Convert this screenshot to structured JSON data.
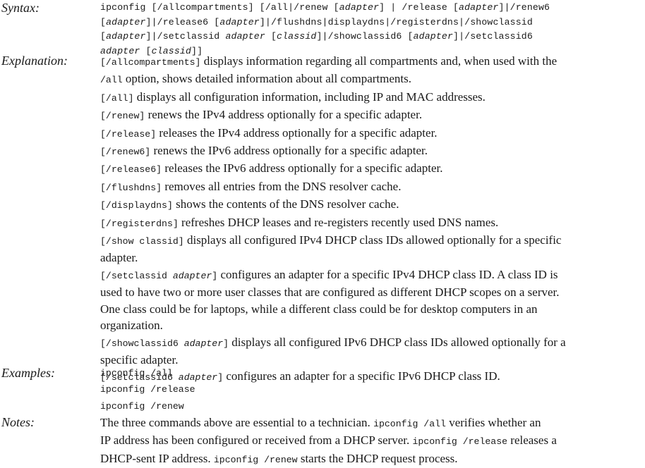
{
  "labels": {
    "syntax": "Syntax",
    "explanation": "Explanation",
    "examples": "Examples",
    "notes": "Notes",
    "colon": ":"
  },
  "syntax": {
    "l1": {
      "p1": "ipconfig [/allcompartments] [/all|/renew [",
      "v1": "adapter",
      "p2": "] | /release [",
      "v2": "adapter",
      "p3": "]|/renew6"
    },
    "l2": {
      "p1": "[",
      "v1": "adapter",
      "p2": "]|/release6 [",
      "v2": "adapter",
      "p3": "]|/flushdns|displaydns|/registerdns|/showclassid"
    },
    "l3": {
      "p1": "[",
      "v1": "adapter",
      "p2": "]|/setclassid ",
      "v2": "adapter",
      "p3": " [",
      "v3": "classid",
      "p4": "]|/showclassid6 [",
      "v4": "adapter",
      "p5": "]|/setclassid6"
    },
    "l4": {
      "v1": "adapter",
      "p1": " [",
      "v2": "classid",
      "p2": "]]"
    }
  },
  "explanation": {
    "e1": {
      "code": "[/allcompartments]",
      "l1": " displays information regarding all compartments and, when used with the",
      "code2": "/all",
      "l2": " option, shows detailed information about all compartments."
    },
    "e2": {
      "code": "[/all]",
      "text": " displays all configuration information, including IP and MAC addresses."
    },
    "e3": {
      "code": "[/renew]",
      "text": " renews the IPv4 address optionally for a specific adapter."
    },
    "e4": {
      "code": "[/release]",
      "text": " releases the IPv4 address optionally for a specific adapter."
    },
    "e5": {
      "code": "[/renew6]",
      "text": " renews the IPv6 address optionally for a specific adapter."
    },
    "e6": {
      "code": "[/release6]",
      "text": " releases the IPv6 address optionally for a specific adapter."
    },
    "e7": {
      "code": "[/flushdns]",
      "text": " removes all entries from the DNS resolver cache."
    },
    "e8": {
      "code": "[/displaydns]",
      "text": " shows the contents of the DNS resolver cache."
    },
    "e9": {
      "code": "[/registerdns]",
      "text": " refreshes DHCP leases and re-registers recently used DNS names."
    },
    "e10": {
      "code": "[/show classid]",
      "l1": " displays all configured IPv4 DHCP class IDs allowed optionally for a specific",
      "l2": "adapter."
    },
    "e11": {
      "code1": "[/setclassid ",
      "var": "adapter",
      "code2": "]",
      "l1": " configures an adapter for a specific IPv4 DHCP class ID. A class ID is",
      "l2": "used to have two or more user classes that are configured as different DHCP scopes on a server.",
      "l3": "One class could be for laptops, while a different class could be for desktop computers in an",
      "l4": "organization."
    },
    "e12": {
      "code1": "[/showclassid6 ",
      "var": "adapter",
      "code2": "]",
      "l1": " displays all configured IPv6 DHCP class IDs allowed optionally for a",
      "l2": "specific adapter."
    },
    "e13": {
      "code1": "[/setclassid6 ",
      "var": "adapter",
      "code2": "]",
      "text": " configures an adapter for a specific IPv6 DHCP class ID."
    }
  },
  "examples": [
    "ipconfig /all",
    "ipconfig /release",
    "ipconfig /renew"
  ],
  "notes": {
    "l1a": "The three commands above are essential to a technician. ",
    "l1code": "ipconfig /all",
    "l1b": " verifies whether an",
    "l2a": "IP address has been configured or received from a DHCP server. ",
    "l2code": "ipconfig /release",
    "l2b": " releases a",
    "l3a": "DHCP-sent IP address. ",
    "l3code": "ipconfig /renew",
    "l3b": " starts the DHCP request process."
  }
}
